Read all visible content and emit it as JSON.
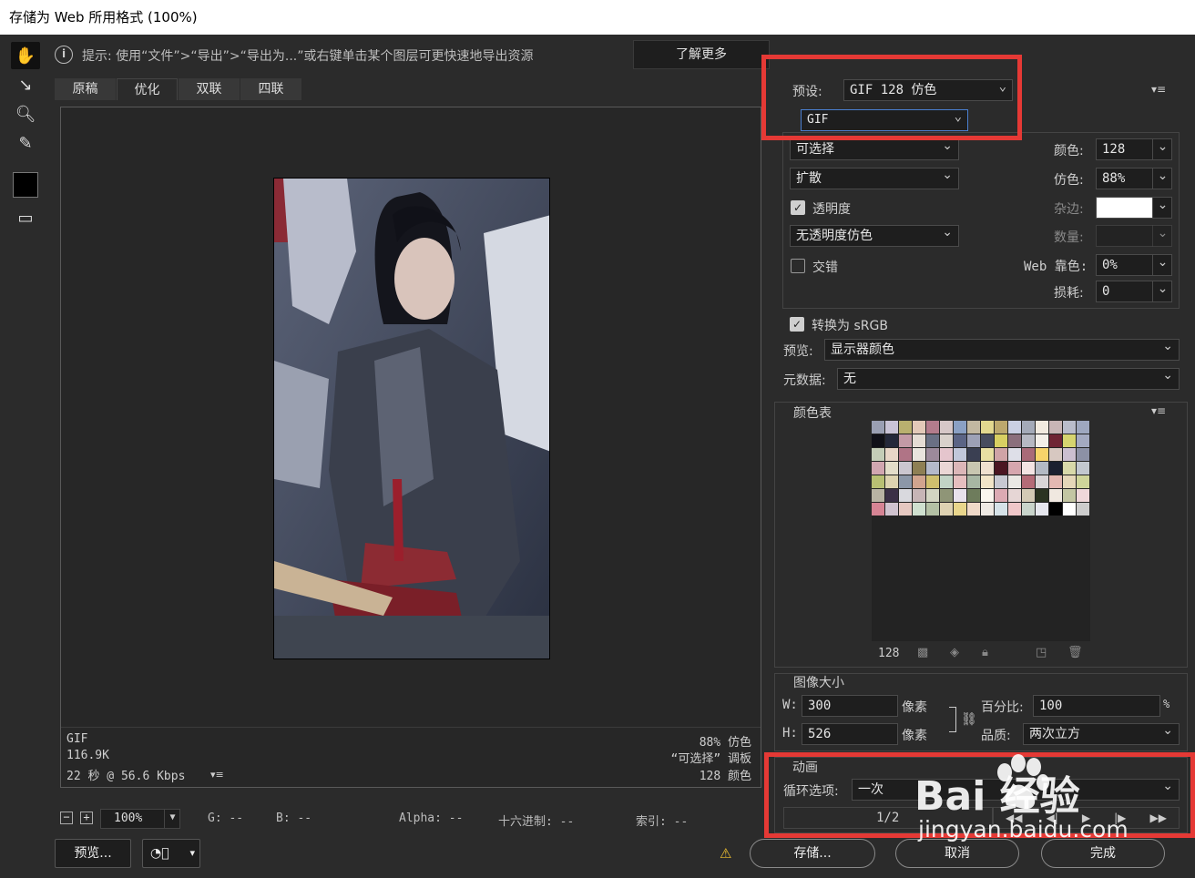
{
  "window": {
    "title": "存储为 Web 所用格式 (100%)"
  },
  "hint": {
    "text": "提示: 使用“文件”>“导出”>“导出为...”或右键单击某个图层可更快速地导出资源",
    "learn_more": "了解更多"
  },
  "tabs": [
    {
      "label": "原稿",
      "active": false
    },
    {
      "label": "优化",
      "active": true
    },
    {
      "label": "双联",
      "active": false
    },
    {
      "label": "四联",
      "active": false
    }
  ],
  "preview_info": {
    "left": [
      "GIF",
      "116.9K",
      "22 秒 @ 56.6 Kbps"
    ],
    "right": [
      "88% 仿色",
      "“可选择” 调板",
      "128 颜色"
    ]
  },
  "status": {
    "zoom": "100%",
    "r": "",
    "g": "G: --",
    "b": "B: --",
    "alpha": "Alpha: --",
    "hex": "十六进制: --",
    "index": "索引: --"
  },
  "buttons": {
    "preview": "预览...",
    "save": "存储...",
    "cancel": "取消",
    "done": "完成"
  },
  "settings": {
    "preset_label": "预设:",
    "preset_value": "GIF 128 仿色",
    "format": "GIF",
    "reduction": "可选择",
    "dither_algo": "扩散",
    "transparency_label": "透明度",
    "transparency_checked": true,
    "transparency_dither": "无透明度仿色",
    "interlaced_label": "交错",
    "interlaced_checked": false,
    "colors_label": "颜色:",
    "colors_value": "128",
    "dither_label": "仿色:",
    "dither_value": "88%",
    "matte_label": "杂边:",
    "matte_color": "#ffffff",
    "amount_label": "数量:",
    "web_snap_label": "Web 靠色:",
    "web_snap_value": "0%",
    "lossy_label": "损耗:",
    "lossy_value": "0",
    "convert_srgb_label": "转换为 sRGB",
    "convert_srgb_checked": true,
    "preview_label": "预览:",
    "preview_value": "显示器颜色",
    "metadata_label": "元数据:",
    "metadata_value": "无"
  },
  "color_table": {
    "title": "颜色表",
    "count": "128",
    "swatches": [
      "#9a9fb3",
      "#c9c3d6",
      "#b9b06f",
      "#e3c9b8",
      "#b37c8c",
      "#d6c7c8",
      "#8aa0c4",
      "#c2b8a1",
      "#e2d88f",
      "#bca86d",
      "#cad0e3",
      "#a4aab8",
      "#f1eadf",
      "#c8b5b6",
      "#b9bccb",
      "#9ea7bf",
      "#101018",
      "#24283a",
      "#c39aa6",
      "#e5dcd4",
      "#6a7084",
      "#d9d1cc",
      "#5b6485",
      "#9da1b6",
      "#474c5e",
      "#d8cf62",
      "#8b6f7c",
      "#b6b8c2",
      "#f3efe8",
      "#6f2434",
      "#d6d46f",
      "#a3a9c0",
      "#c4cdb7",
      "#e8d6c7",
      "#b07486",
      "#e9e4dd",
      "#9c8a9b",
      "#e5c5cd",
      "#c1c7da",
      "#3a3f52",
      "#e8dfa2",
      "#cfa3a6",
      "#dedfe8",
      "#a96a78",
      "#f7d36a",
      "#d7c8c1",
      "#cbbfd0",
      "#8c91a6",
      "#d1a6b0",
      "#e3ddc9",
      "#cbc6cf",
      "#8e7f54",
      "#b4b9ca",
      "#ead6d5",
      "#dcb6b8",
      "#c8c6b0",
      "#efe0cf",
      "#4b1622",
      "#d6a6ae",
      "#f3e4e3",
      "#b3bac4",
      "#1b2030",
      "#d8d9a9",
      "#c2c8cf",
      "#b8bf73",
      "#ddd3b0",
      "#8c97a8",
      "#d1a48e",
      "#cfbf6e",
      "#c2d3c6",
      "#e6bebf",
      "#a7b6a3",
      "#f2e5c8",
      "#c7c8d1",
      "#eae8e4",
      "#b46b77",
      "#d9d5d7",
      "#e3b8b2",
      "#e5d7b8",
      "#cfd59a",
      "#b8b3a3",
      "#3b3046",
      "#d9d9de",
      "#c7b5b6",
      "#d3d5c2",
      "#8f9577",
      "#e8e1ec",
      "#6e7c5c",
      "#faf6ee",
      "#dcaab3",
      "#e6d6d5",
      "#d3c9b5",
      "#2a3321",
      "#f0e8e0",
      "#c3c6a3",
      "#efd8da",
      "#d68494",
      "#d0c3cf",
      "#e6c8c1",
      "#cfe0cf",
      "#b4c1a5",
      "#ded2b2",
      "#e9d68c",
      "#efd9c8",
      "#efeae4",
      "#d6e2e8",
      "#f0c7c9",
      "#c9d4cb",
      "#e6e7ee",
      "#000000",
      "#ffffff",
      "#cccccc"
    ]
  },
  "image_size": {
    "title": "图像大小",
    "w_label": "W:",
    "w_value": "300",
    "h_label": "H:",
    "h_value": "526",
    "unit": "像素",
    "percent_label": "百分比:",
    "percent_value": "100",
    "percent_unit": "%",
    "quality_label": "品质:",
    "quality_value": "两次立方"
  },
  "animation": {
    "title": "动画",
    "loop_label": "循环选项:",
    "loop_value": "一次",
    "frame": "1/2"
  },
  "watermark": {
    "logo": "Bai  经验",
    "url": "jingyan.baidu.com"
  },
  "highlight_color": "#e53935"
}
